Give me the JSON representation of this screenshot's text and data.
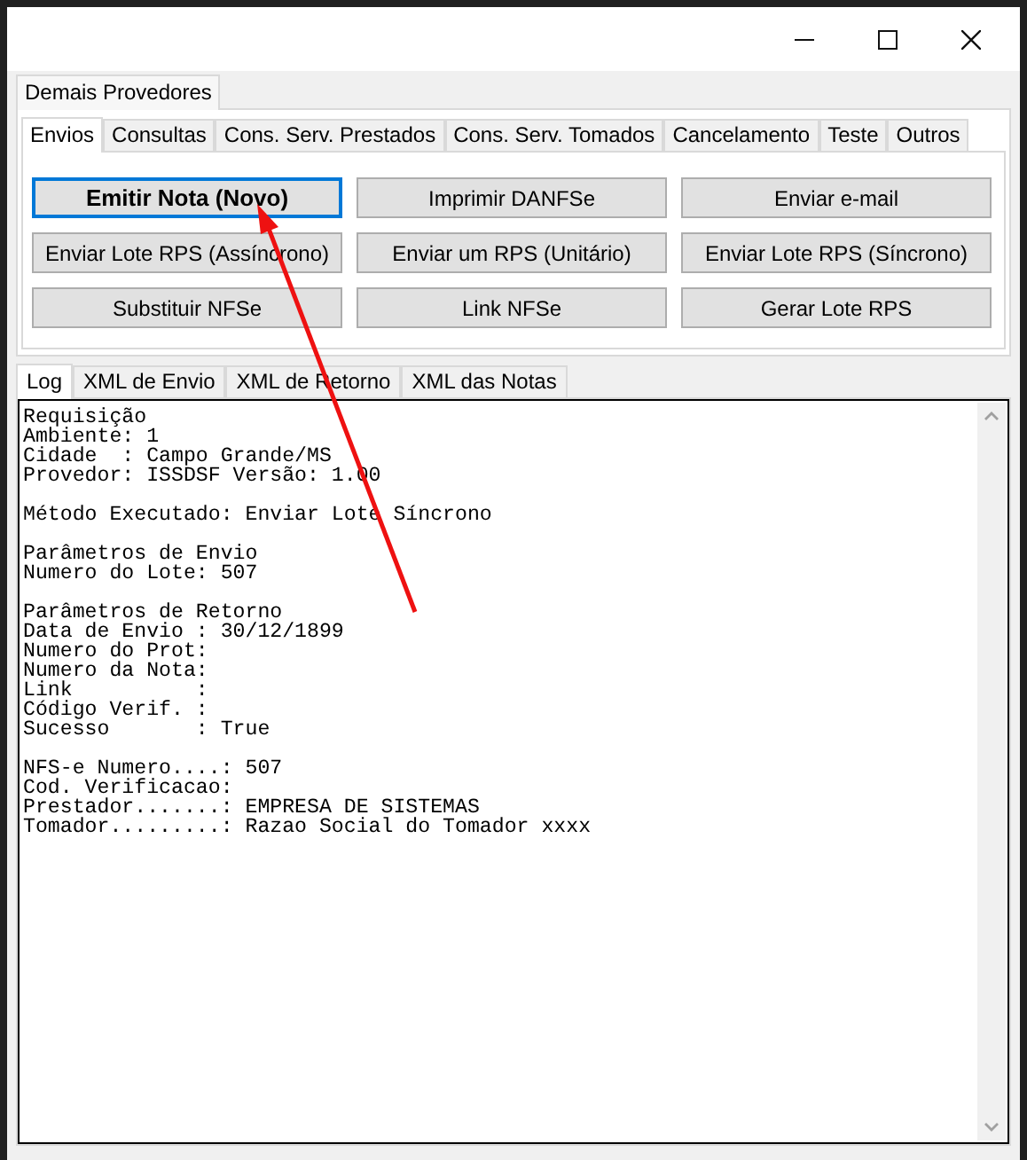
{
  "outer_tabs": [
    {
      "label": "Demais Provedores",
      "selected": true
    }
  ],
  "tabs": [
    {
      "label": "Envios",
      "selected": true
    },
    {
      "label": "Consultas",
      "selected": false
    },
    {
      "label": "Cons. Serv. Prestados",
      "selected": false
    },
    {
      "label": "Cons. Serv. Tomados",
      "selected": false
    },
    {
      "label": "Cancelamento",
      "selected": false
    },
    {
      "label": "Teste",
      "selected": false
    },
    {
      "label": "Outros",
      "selected": false
    }
  ],
  "buttons": [
    {
      "label": "Emitir Nota (Novo)",
      "focused": true
    },
    {
      "label": "Imprimir DANFSe",
      "focused": false
    },
    {
      "label": "Enviar e-mail",
      "focused": false
    },
    {
      "label": "Enviar Lote RPS (Assíncrono)",
      "focused": false
    },
    {
      "label": "Enviar um RPS (Unitário)",
      "focused": false
    },
    {
      "label": "Enviar Lote RPS (Síncrono)",
      "focused": false
    },
    {
      "label": "Substituir NFSe",
      "focused": false
    },
    {
      "label": "Link NFSe",
      "focused": false
    },
    {
      "label": "Gerar Lote RPS",
      "focused": false
    }
  ],
  "log_tabs": [
    {
      "label": "Log",
      "selected": true
    },
    {
      "label": "XML de Envio",
      "selected": false
    },
    {
      "label": "XML de Retorno",
      "selected": false
    },
    {
      "label": "XML das Notas",
      "selected": false
    }
  ],
  "log": [
    [
      "Requisição",
      "Ambiente: 1",
      "Cidade  : Campo Grande/MS",
      "Provedor: ISSDSF Versão: 1.00"
    ],
    [
      "Método Executado: Enviar Lote Síncrono"
    ],
    [
      "Parâmetros de Envio",
      "Numero do Lote: 507"
    ],
    [
      "Parâmetros de Retorno",
      "Data de Envio : 30/12/1899",
      "Numero do Prot:",
      "Numero da Nota:",
      "Link          :",
      "Código Verif. :",
      "Sucesso       : True"
    ],
    [
      "NFS-e Numero....: 507",
      "Cod. Verificacao:",
      "Prestador.......: EMPRESA DE SISTEMAS",
      "Tomador.........: Razao Social do Tomador xxxx"
    ]
  ]
}
